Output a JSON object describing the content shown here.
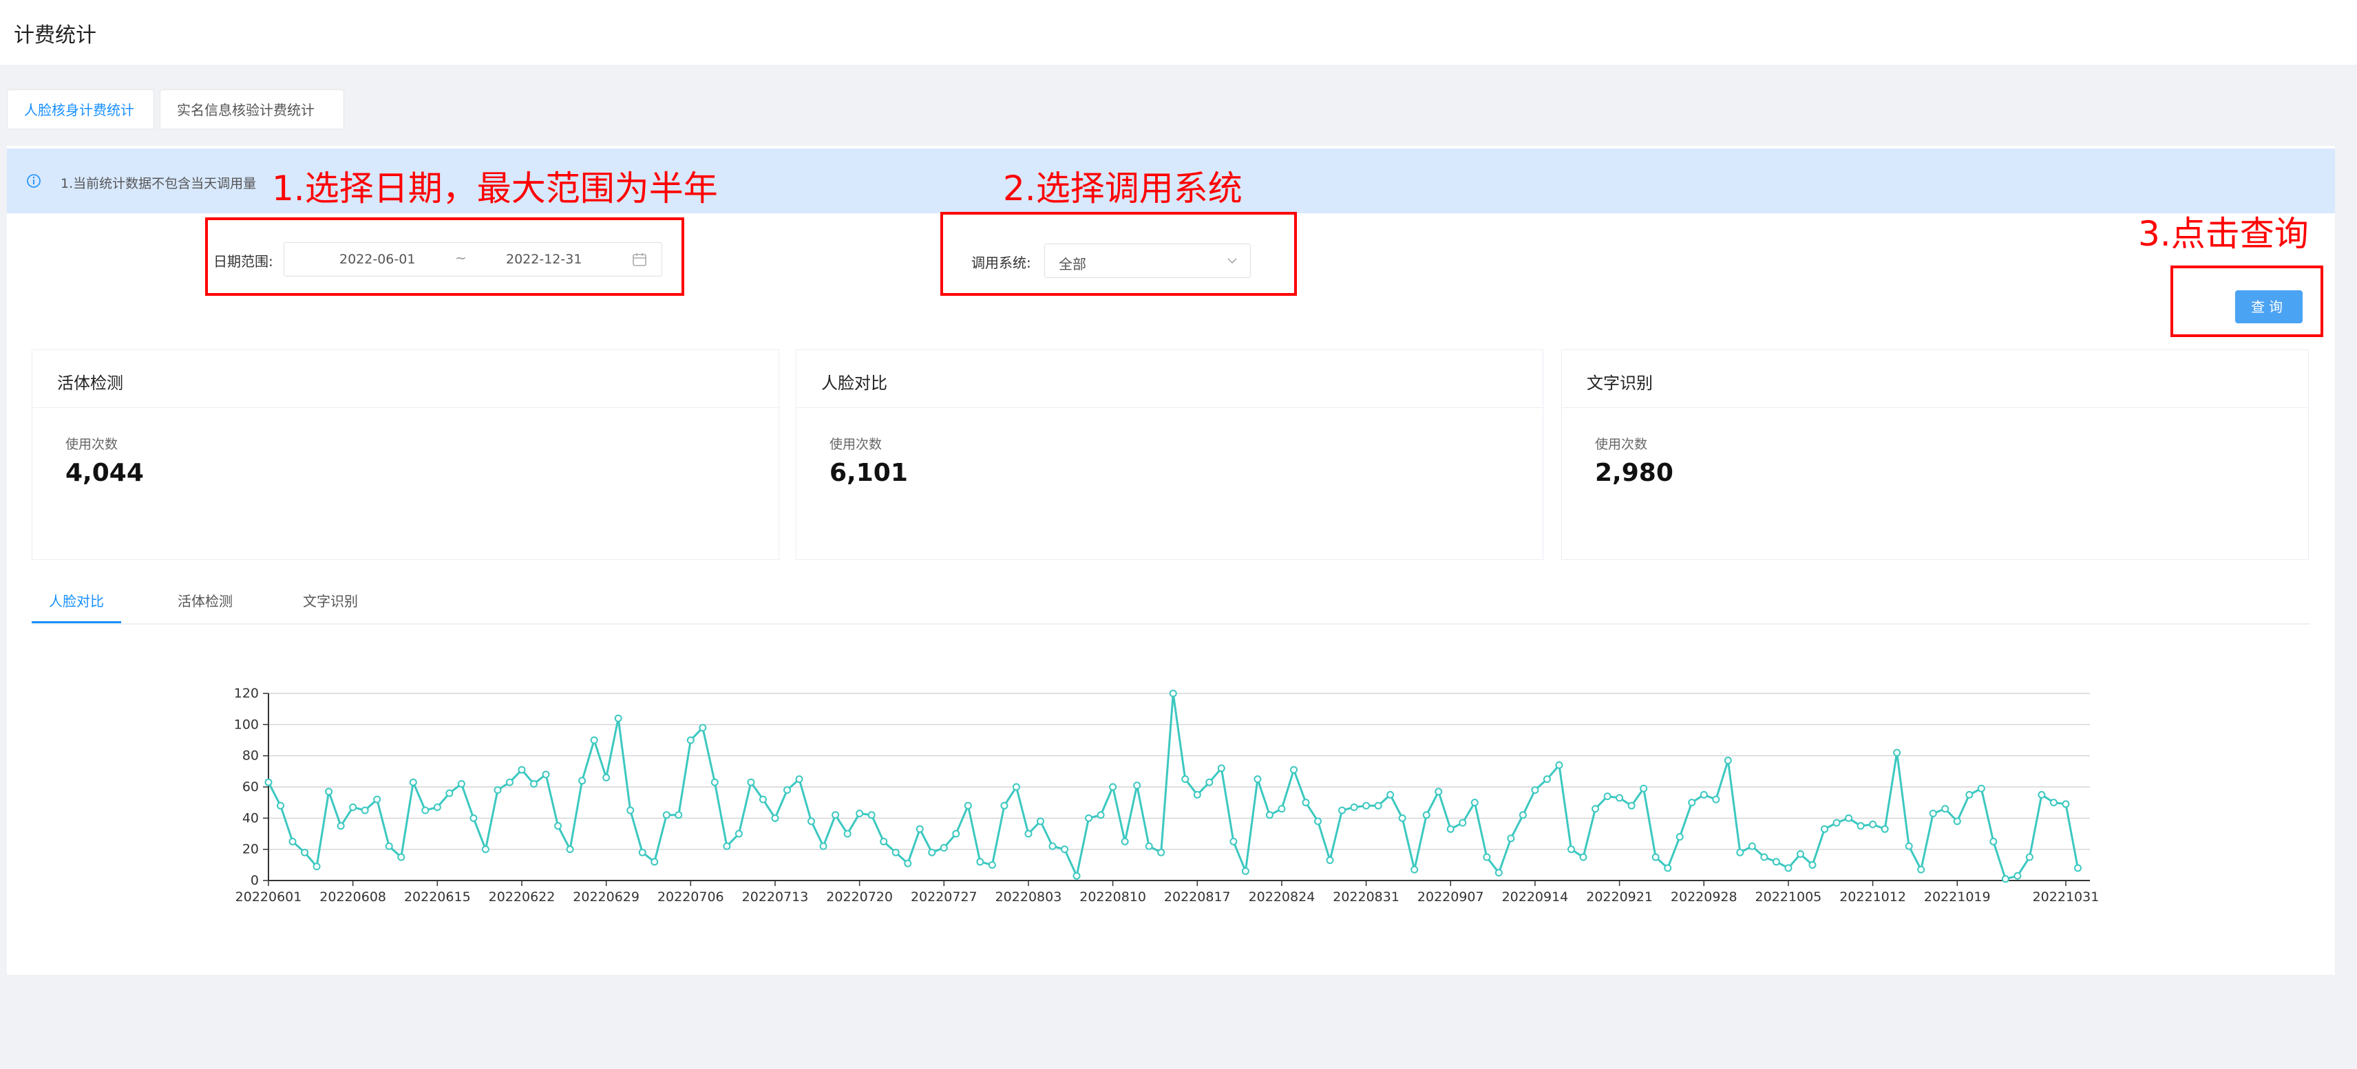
{
  "page": {
    "title": "计费统计"
  },
  "top_tabs": [
    {
      "label": "人脸核身计费统计",
      "active": true
    },
    {
      "label": "实名信息核验计费统计",
      "active": false
    }
  ],
  "notice": {
    "text": "1.当前统计数据不包含当天调用量"
  },
  "annotations": {
    "step1": "1.选择日期，最大范围为半年",
    "step2": "2.选择调用系统",
    "step3": "3.点击查询"
  },
  "filters": {
    "date_label": "日期范围:",
    "start_date": "2022-06-01",
    "separator": "~",
    "end_date": "2022-12-31",
    "system_label": "调用系统:",
    "system_value": "全部"
  },
  "query_button": "查询",
  "cards": [
    {
      "title": "活体检测",
      "sub": "使用次数",
      "value": "4,044"
    },
    {
      "title": "人脸对比",
      "sub": "使用次数",
      "value": "6,101"
    },
    {
      "title": "文字识别",
      "sub": "使用次数",
      "value": "2,980"
    }
  ],
  "chart_tabs": [
    {
      "label": "人脸对比",
      "active": true
    },
    {
      "label": "活体检测",
      "active": false
    },
    {
      "label": "文字识别",
      "active": false
    }
  ],
  "colors": {
    "accent": "#1890ff",
    "line": "#3cc8c0",
    "annotation": "#ff0000",
    "notice_bg": "#d8e8fd"
  },
  "chart_data": {
    "type": "line",
    "title": "",
    "xlabel": "",
    "ylabel": "",
    "ylim": [
      0,
      120
    ],
    "yticks": [
      0,
      20,
      40,
      60,
      80,
      100,
      120
    ],
    "grid": true,
    "x_tick_labels": [
      "20220601",
      "20220608",
      "20220615",
      "20220622",
      "20220629",
      "20220706",
      "20220713",
      "20220720",
      "20220727",
      "20220803",
      "20220810",
      "20220817",
      "20220824",
      "20220831",
      "20220907",
      "20220914",
      "20220921",
      "20220928",
      "20221005",
      "20221012",
      "20221019",
      "20221031"
    ],
    "series": [
      {
        "values": [
          63,
          48,
          25,
          18,
          9,
          57,
          35,
          47,
          45,
          52,
          22,
          15,
          63,
          45,
          47,
          56,
          62,
          40,
          20,
          58,
          63,
          71,
          62,
          68,
          35,
          20,
          64,
          90,
          66,
          104,
          45,
          18,
          12,
          42,
          42,
          90,
          98,
          63,
          22,
          30,
          63,
          52,
          40,
          58,
          65,
          38,
          22,
          42,
          30,
          43,
          42,
          25,
          18,
          11,
          33,
          18,
          21,
          30,
          48,
          12,
          10,
          48,
          60,
          30,
          38,
          22,
          20,
          3,
          40,
          42,
          60,
          25,
          61,
          22,
          18,
          120,
          65,
          55,
          63,
          72,
          25,
          6,
          65,
          42,
          46,
          71,
          50,
          38,
          13,
          45,
          47,
          48,
          48,
          55,
          40,
          7,
          42,
          57,
          33,
          37,
          50,
          15,
          5,
          27,
          42,
          58,
          65,
          74,
          20,
          15,
          46,
          54,
          53,
          48,
          59,
          15,
          8,
          28,
          50,
          55,
          52,
          77,
          18,
          22,
          15,
          12,
          8,
          17,
          10,
          33,
          37,
          40,
          35,
          36,
          33,
          82,
          22,
          7,
          43,
          46,
          38,
          55,
          59,
          25,
          1,
          3,
          15,
          55,
          50,
          49,
          8
        ]
      }
    ]
  }
}
